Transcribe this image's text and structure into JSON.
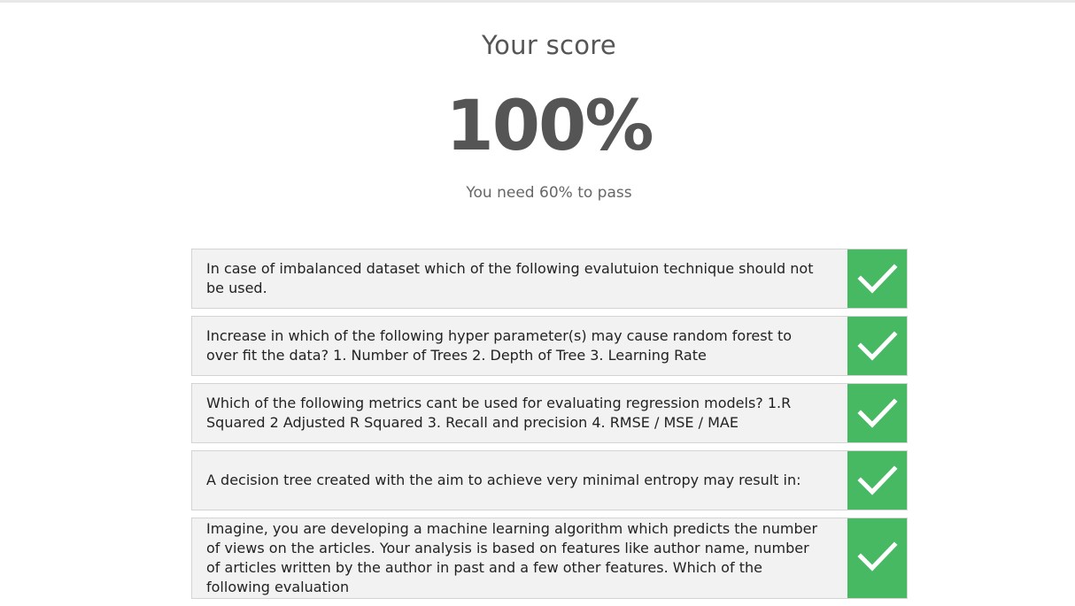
{
  "score": {
    "title": "Your score",
    "value": "100%",
    "pass_note": "You need 60% to pass"
  },
  "results": [
    {
      "question": "In case of imbalanced dataset which of the following evalutuion technique should not be used.",
      "status": "correct",
      "icon": "checkmark-icon"
    },
    {
      "question": "Increase in which of the following hyper parameter(s) may cause random forest to over fit the data? 1. Number of Trees 2. Depth of Tree 3. Learning Rate",
      "status": "correct",
      "icon": "checkmark-icon"
    },
    {
      "question": "Which of the following metrics cant be used for evaluating regression models? 1.R Squared 2 Adjusted R Squared 3. Recall and precision 4. RMSE / MSE / MAE",
      "status": "correct",
      "icon": "checkmark-icon"
    },
    {
      "question": "A decision tree created with the aim to achieve very minimal entropy may result in:",
      "status": "correct",
      "icon": "checkmark-icon"
    },
    {
      "question": "Imagine, you are developing a machine learning algorithm which predicts the number of views on the articles. Your analysis is based on features like author name, number of articles written by the author in past and a few other features. Which of the following evaluation",
      "status": "correct",
      "icon": "checkmark-icon"
    }
  ],
  "colors": {
    "correct": "#48b963",
    "row_background": "#f2f2f2",
    "row_border": "#d4d4d4",
    "score_text": "#555555"
  }
}
